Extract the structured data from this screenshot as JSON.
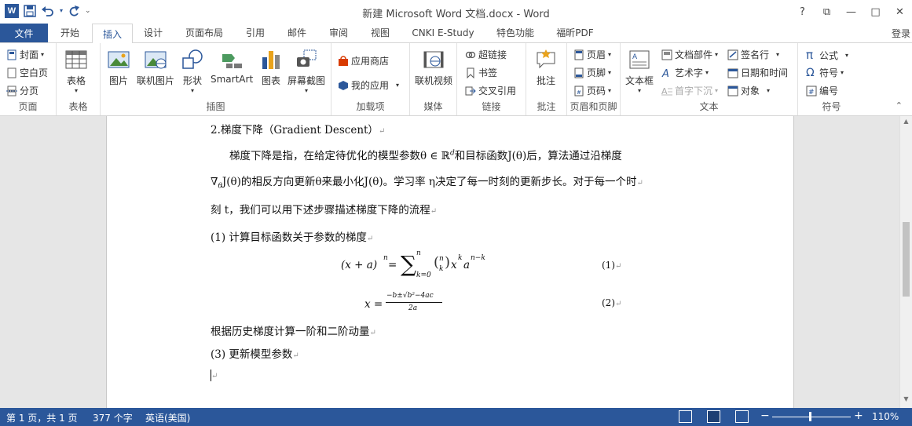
{
  "titlebar": {
    "app_icon_letter": "W",
    "title": "新建 Microsoft Word 文档.docx - Word",
    "help": "?",
    "minimize": "—",
    "restore": "□",
    "close": "✕",
    "ribbon_display": "⧉"
  },
  "tabs": {
    "file": "文件",
    "items": [
      "开始",
      "插入",
      "设计",
      "页面布局",
      "引用",
      "邮件",
      "审阅",
      "视图",
      "CNKI E-Study",
      "特色功能",
      "福昕PDF"
    ],
    "active": "插入",
    "login": "登录"
  },
  "ribbon": {
    "pages": {
      "label": "页面",
      "cover": "封面",
      "blank": "空白页",
      "break": "分页"
    },
    "tables": {
      "label": "表格",
      "table": "表格"
    },
    "illustrations": {
      "label": "插图",
      "picture": "图片",
      "online_picture": "联机图片",
      "shapes": "形状",
      "smartart": "SmartArt",
      "chart": "图表",
      "screenshot": "屏幕截图"
    },
    "addins": {
      "label": "加载项",
      "store": "应用商店",
      "my_apps": "我的应用"
    },
    "media": {
      "label": "媒体",
      "online_video": "联机视频"
    },
    "links": {
      "label": "链接",
      "hyperlink": "超链接",
      "bookmark": "书签",
      "cross_ref": "交叉引用"
    },
    "comments": {
      "label": "批注",
      "comment": "批注"
    },
    "header_footer": {
      "label": "页眉和页脚",
      "header": "页眉",
      "footer": "页脚",
      "page_number": "页码"
    },
    "text": {
      "label": "文本",
      "textbox": "文本框",
      "quick_parts": "文档部件",
      "wordart": "艺术字",
      "dropcap": "首字下沉",
      "signature": "签名行",
      "datetime": "日期和时间",
      "object": "对象"
    },
    "symbols": {
      "label": "符号",
      "equation": "公式",
      "symbol": "符号",
      "numbering": "编号"
    }
  },
  "document": {
    "heading": "2.梯度下降（Gradient Descent）",
    "p1_line1": "梯度下降是指，在给定待优化的模型参数θ ∈ ℝ",
    "p1_sup": "d",
    "p1_line1b": "和目标函数J(θ)后，算法通过沿梯度",
    "p1_line2": "∇",
    "p1_line2_sub": "θ",
    "p1_line2b": "J(θ)的相反方向更新θ来最小化J(θ)。学习率 η决定了每一时刻的更新步长。对于每一个时",
    "p1_line3": "刻 t，我们可以用下述步骤描述梯度下降的流程",
    "step1": "(1)  计算目标函数关于参数的梯度",
    "eq1_lhs": "(x + a)",
    "eq1_lhs_sup": "n",
    "eq1_eq": " = ",
    "eq1_sum": "∑",
    "eq1_sum_top": "n",
    "eq1_sum_bottom": "k=0",
    "eq1_binom_top": "n",
    "eq1_binom_bottom": "k",
    "eq1_rhs": "x",
    "eq1_rhs_sup1": "k",
    "eq1_rhs2": "a",
    "eq1_rhs_sup2": "n−k",
    "eq1_no": "(1)",
    "eq2_lhs": "x = ",
    "eq2_num": "−b±√b²−4ac",
    "eq2_den": "2a",
    "eq2_no": "(2)",
    "step2": "根据历史梯度计算一阶和二阶动量",
    "step3": "(3)  更新模型参数",
    "para_mark": "↵"
  },
  "status": {
    "page": "第 1 页，共 1 页",
    "words": "377 个字",
    "language": "英语(美国)",
    "zoom_minus": "−",
    "zoom_plus": "+",
    "zoom": "110%",
    "zoom_level_fraction": 0.48
  }
}
